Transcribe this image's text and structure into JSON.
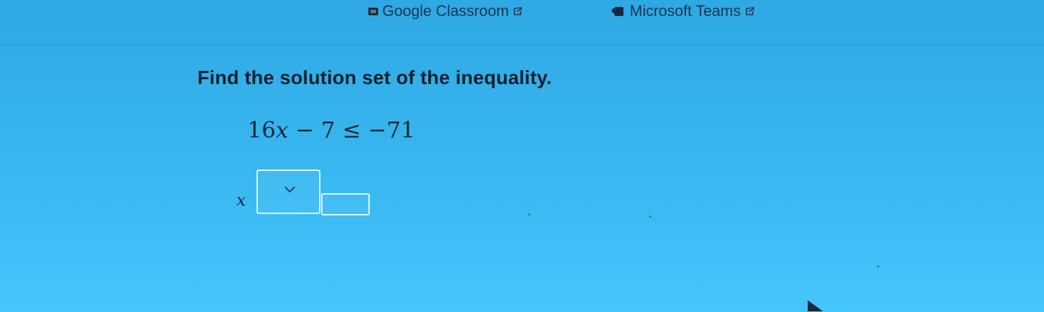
{
  "topbar": {
    "links": [
      {
        "label": "Google Classroom",
        "icon": "google-classroom-icon"
      },
      {
        "label": "Microsoft Teams",
        "icon": "microsoft-teams-icon"
      }
    ]
  },
  "problem": {
    "prompt": "Find the solution set of the inequality.",
    "inequality": {
      "coefficient": "16",
      "variable": "x",
      "minus": "−",
      "constant": "7",
      "relation": "≤",
      "rhs": "−71"
    }
  },
  "answer": {
    "variable": "x",
    "relation_selected": "",
    "value": ""
  },
  "colors": {
    "background_top": "#2fa8e3",
    "background_bottom": "#45c6fb",
    "text": "#10212f",
    "input_border": "#e8f6ff"
  }
}
